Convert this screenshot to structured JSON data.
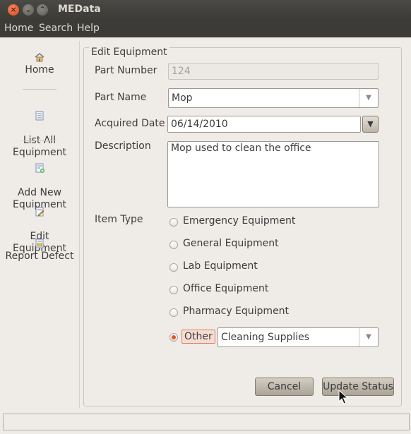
{
  "window": {
    "title": "MEData"
  },
  "menubar": {
    "items": [
      "Home",
      "Search",
      "Help"
    ]
  },
  "sidebar": {
    "items": [
      {
        "label": "Home",
        "icon": "home-icon"
      },
      {
        "label": "List All\nEquipment",
        "icon": "list-icon"
      },
      {
        "label": "Add New\nEquipment",
        "icon": "add-equipment-icon"
      },
      {
        "label": "Edit\nEquipment",
        "icon": "edit-equipment-icon"
      },
      {
        "label": "Report Defect",
        "icon": "report-defect-icon"
      }
    ]
  },
  "form": {
    "legend": "Edit Equipment",
    "part_number": {
      "label": "Part Number",
      "value": "124"
    },
    "part_name": {
      "label": "Part Name",
      "value": "Mop"
    },
    "acquired_date": {
      "label": "Acquired Date",
      "value": "06/14/2010"
    },
    "description": {
      "label": "Description",
      "value": "Mop used to clean the office"
    },
    "item_type": {
      "label": "Item Type",
      "options": [
        "Emergency Equipment",
        "General Equipment",
        "Lab Equipment",
        "Office Equipment",
        "Pharmacy Equipment",
        "Other"
      ],
      "selected": "Other",
      "other_value": "Cleaning Supplies"
    }
  },
  "buttons": {
    "cancel": "Cancel",
    "update": "Update Status"
  },
  "status": {
    "text": ""
  },
  "colors": {
    "accent": "#e4542a",
    "titlebar": "#3c3b37"
  }
}
